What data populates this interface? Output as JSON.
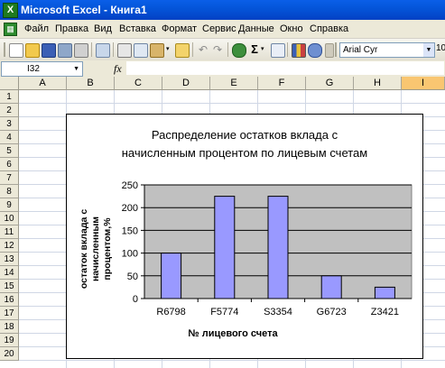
{
  "window": {
    "title": "Microsoft Excel - Книга1",
    "app_icon_letter": "X"
  },
  "menu": {
    "items": [
      "Файл",
      "Правка",
      "Вид",
      "Вставка",
      "Формат",
      "Сервис",
      "Данные",
      "Окно",
      "Справка"
    ]
  },
  "toolbar": {
    "font_name": "Arial Cyr",
    "font_size": "10",
    "sigma_label": "Σ"
  },
  "formula_bar": {
    "cell_ref": "I32",
    "fx_label": "fx",
    "value": ""
  },
  "grid": {
    "columns": [
      "A",
      "B",
      "C",
      "D",
      "E",
      "F",
      "G",
      "H",
      "I"
    ],
    "active_column": "I",
    "rows": [
      "1",
      "2",
      "3",
      "4",
      "5",
      "6",
      "7",
      "8",
      "9",
      "10",
      "11",
      "12",
      "13",
      "14",
      "15",
      "16",
      "17",
      "18",
      "19",
      "20"
    ]
  },
  "colors": {
    "bar_fill": "#9999ff",
    "plot_bg": "#c0c0c0",
    "titlebar": "#0454d8",
    "active_header": "#f9c671"
  },
  "chart_data": {
    "type": "bar",
    "title_line1": "Распределение остатков вклада с",
    "title_line2": "начисленным процентом по лицевым счетам",
    "xlabel": "№ лицевого счета",
    "ylabel_line1": "остаток вклада с",
    "ylabel_line2": "начисленным",
    "ylabel_line3": "процентом,%",
    "categories": [
      "R6798",
      "F5774",
      "S3354",
      "G6723",
      "Z3421"
    ],
    "values": [
      100,
      225,
      225,
      50,
      25
    ],
    "ylim": [
      0,
      250
    ],
    "yticks": [
      0,
      50,
      100,
      150,
      200,
      250
    ],
    "ytick_labels": [
      "0",
      "50",
      "100",
      "150",
      "200",
      "250"
    ],
    "grid": true,
    "legend": "none"
  }
}
